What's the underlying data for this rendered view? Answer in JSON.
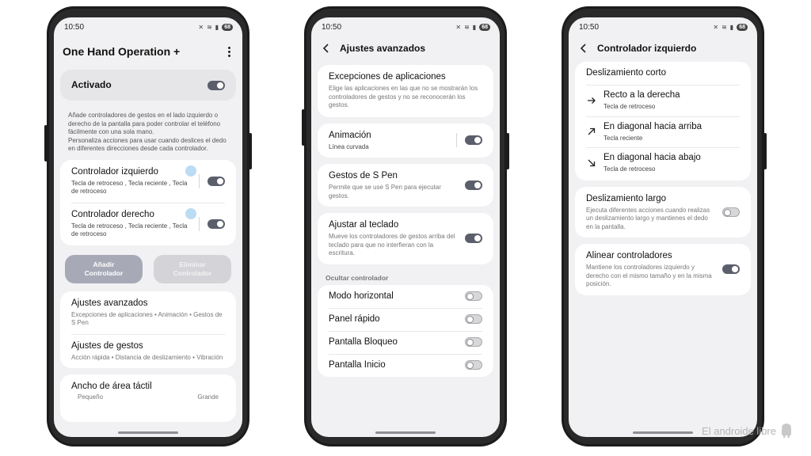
{
  "status": {
    "time": "10:50",
    "battery": "68"
  },
  "screen1": {
    "title": "One Hand Operation +",
    "master": {
      "label": "Activado",
      "on": true
    },
    "description": "Añade controladores de gestos en el lado izquierdo o derecho de la pantalla para poder controlar el teléfono fácilmente con una sola mano.\nPersonaliza acciones para usar cuando deslices el dedo en diferentes direcciones desde cada controlador.",
    "controllers": [
      {
        "title": "Controlador izquierdo",
        "subtitle": "Tecla de retroceso , Tecla reciente , Tecla de retroceso",
        "on": true
      },
      {
        "title": "Controlador derecho",
        "subtitle": "Tecla de retroceso , Tecla reciente , Tecla de retroceso",
        "on": true
      }
    ],
    "add_button": "Añadir\nControlador",
    "remove_button": "Eliminar\nControlador",
    "settings": [
      {
        "title": "Ajustes avanzados",
        "subtitle": "Excepciones de aplicaciones • Animación • Gestos de S Pen"
      },
      {
        "title": "Ajustes de gestos",
        "subtitle": "Acción rápida • Distancia de deslizamiento • Vibración"
      }
    ],
    "touch_area": {
      "title": "Ancho de área táctil",
      "min_label": "Pequeño",
      "max_label": "Grande"
    }
  },
  "screen2": {
    "title": "Ajustes avanzados",
    "exceptions": {
      "title": "Excepciones de aplicaciones",
      "subtitle": "Elige las aplicaciones en las que no se mostrarán los controladores de gestos y no se reconocerán los gestos."
    },
    "animation": {
      "title": "Animación",
      "subtitle": "Línea curvada",
      "on": true
    },
    "spen": {
      "title": "Gestos de S Pen",
      "subtitle": "Permite que se use S Pen para ejecutar gestos.",
      "on": true
    },
    "keyboard": {
      "title": "Ajustar al teclado",
      "subtitle": "Mueve los controladores de gestos arriba del teclado para que no interfieran con la escritura.",
      "on": true
    },
    "hide_section_label": "Ocultar controlador",
    "hide_items": [
      {
        "title": "Modo horizontal",
        "on": false
      },
      {
        "title": "Panel rápido",
        "on": false
      },
      {
        "title": "Pantalla Bloqueo",
        "on": false
      },
      {
        "title": "Pantalla Inicio",
        "on": false
      }
    ]
  },
  "screen3": {
    "title": "Controlador izquierdo",
    "short_swipe": {
      "header": "Deslizamiento corto",
      "items": [
        {
          "title": "Recto a la derecha",
          "subtitle": "Tecla de retroceso",
          "icon": "arrow-right-icon"
        },
        {
          "title": "En diagonal hacia arriba",
          "subtitle": "Tecla reciente",
          "icon": "arrow-up-right-icon"
        },
        {
          "title": "En diagonal hacia abajo",
          "subtitle": "Tecla de retroceso",
          "icon": "arrow-down-right-icon"
        }
      ]
    },
    "long_swipe": {
      "title": "Deslizamiento largo",
      "subtitle": "Ejecuta diferentes acciones cuando realizas un deslizamiento largo y mantienes el dedo en la pantalla.",
      "on": false
    },
    "align": {
      "title": "Alinear controladores",
      "subtitle": "Mantiene los controladores izquierdo y derecho con el mismo tamaño y en la misma posición.",
      "on": true
    }
  },
  "watermark": {
    "text": "El androide libre"
  }
}
